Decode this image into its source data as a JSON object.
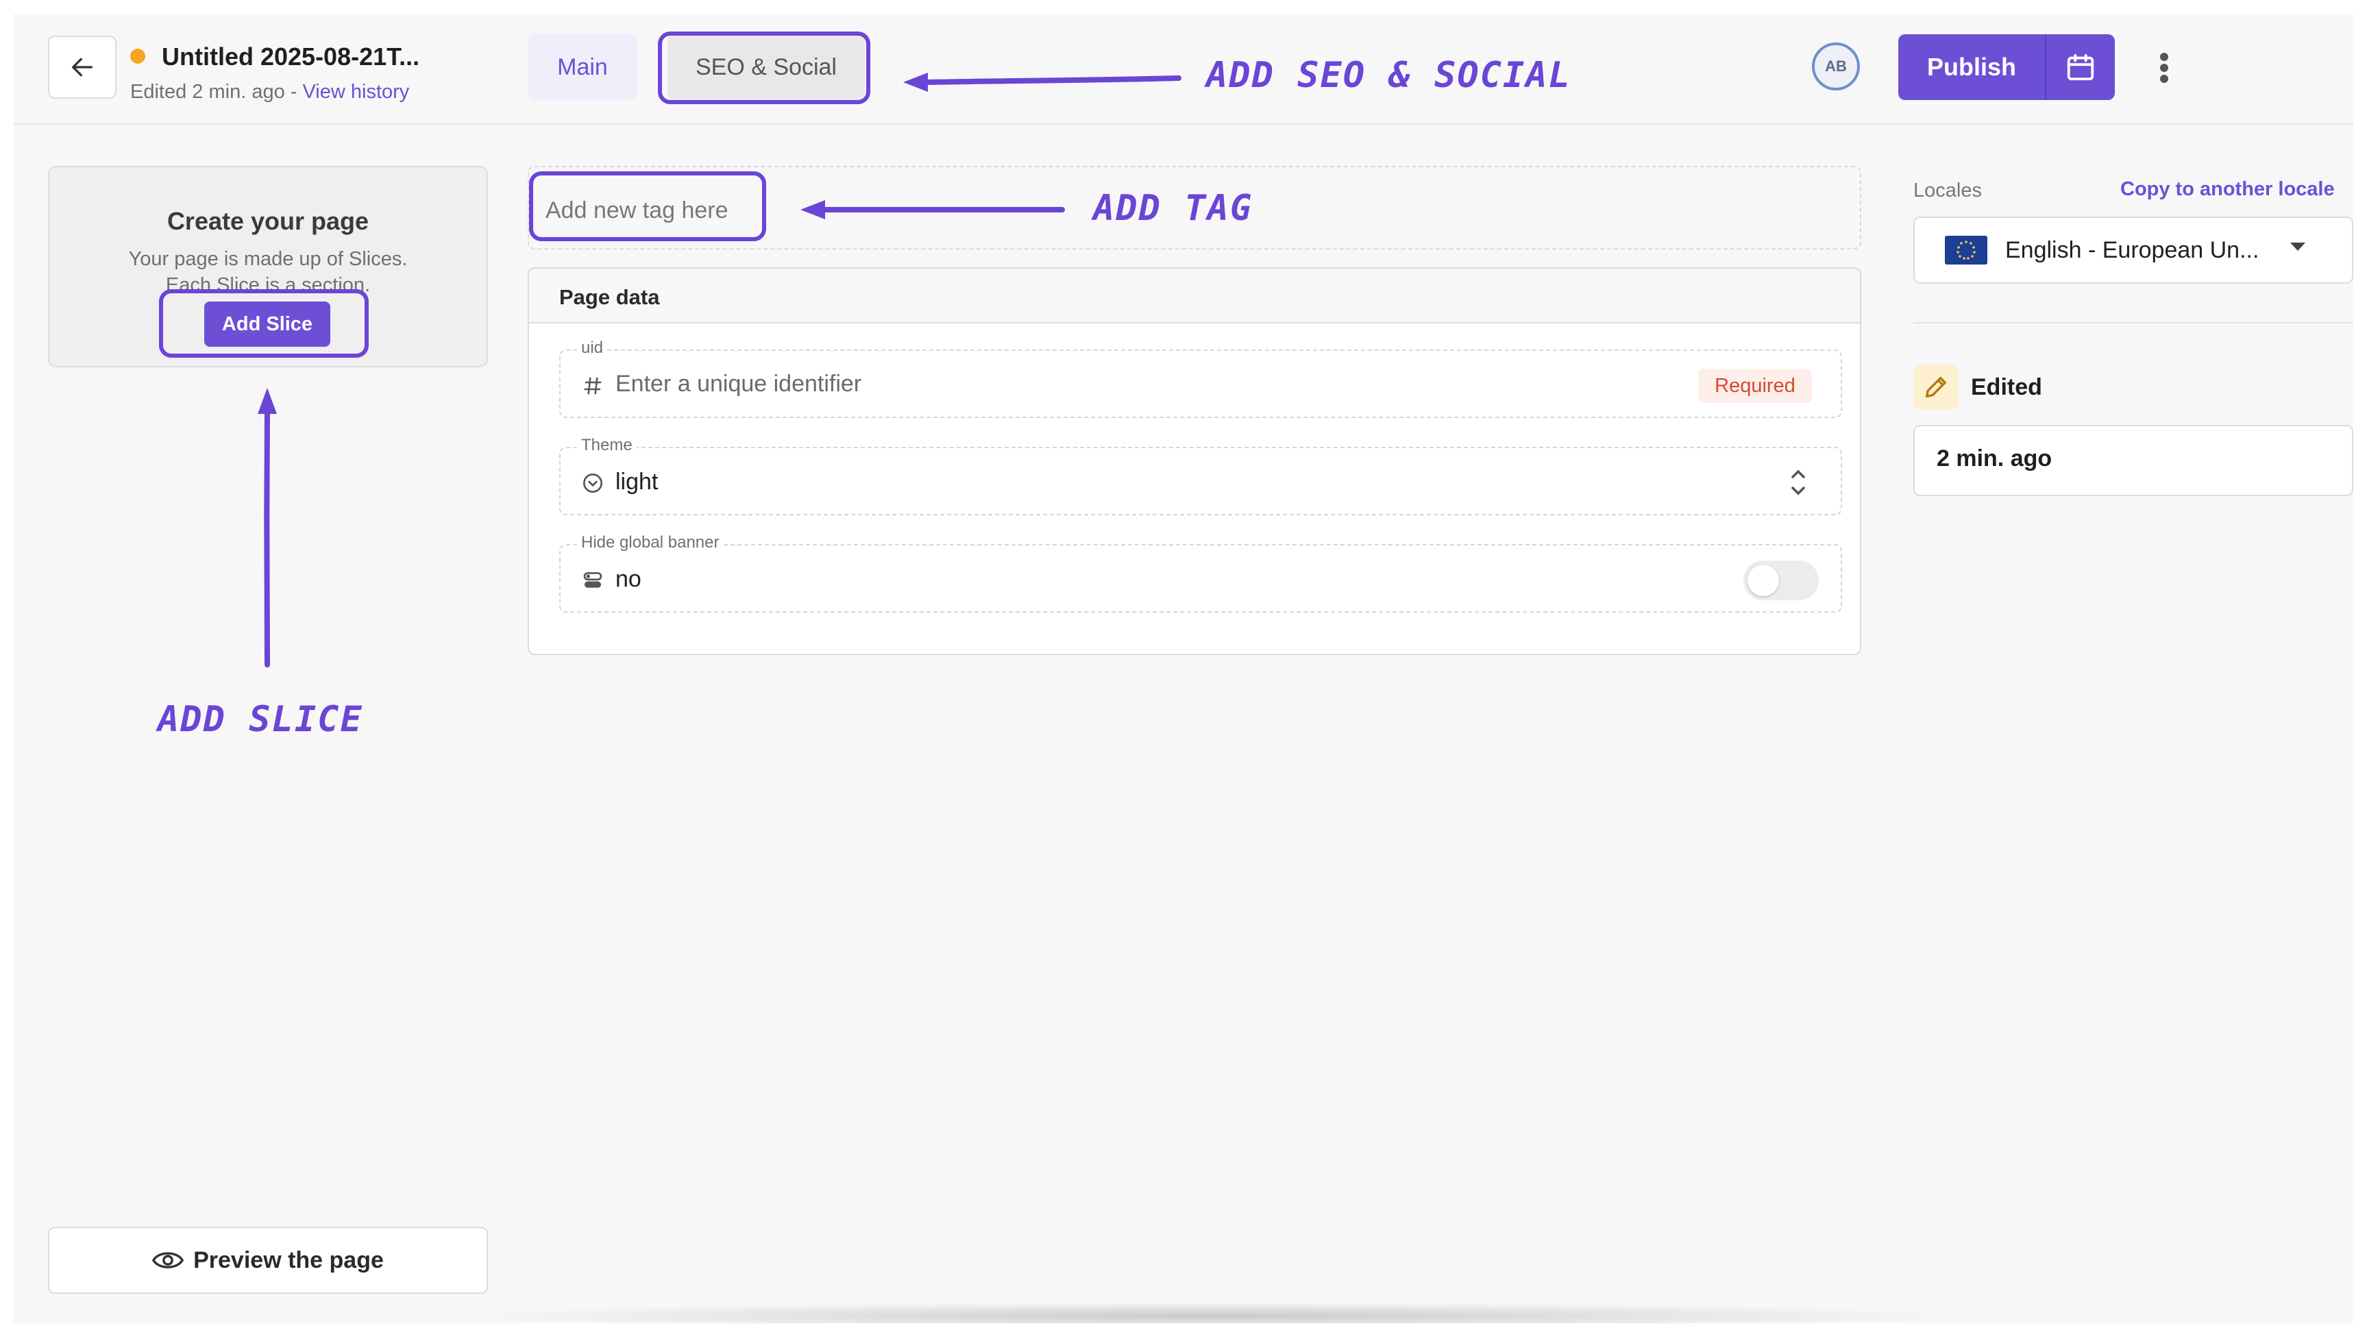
{
  "header": {
    "doc_title": "Untitled 2025-08-21T...",
    "edited_text": "Edited 2 min. ago - ",
    "view_history": "View history",
    "tabs": [
      {
        "label": "Main",
        "active": true
      },
      {
        "label": "SEO & Social",
        "active": false
      }
    ],
    "avatar_initials": "AB",
    "publish_label": "Publish",
    "status_color": "#f5a623",
    "accent_color": "#6d4fd6"
  },
  "annotations": {
    "seo": "ADD SEO & SOCIAL",
    "tag": "ADD TAG",
    "slice": "ADD SLICE",
    "color": "#6a45d6"
  },
  "sidebar": {
    "create_title": "Create your page",
    "create_desc_line1": "Your page is made up of Slices.",
    "create_desc_line2": "Each Slice is a section.",
    "add_slice_label": "Add Slice",
    "preview_label": "Preview the page"
  },
  "tags": {
    "placeholder": "Add new tag here"
  },
  "page_data": {
    "title": "Page data",
    "fields": {
      "uid": {
        "label": "uid",
        "placeholder": "Enter a unique identifier",
        "badge": "Required"
      },
      "theme": {
        "label": "Theme",
        "value": "light"
      },
      "banner": {
        "label": "Hide global banner",
        "value": "no",
        "toggle_on": false
      }
    }
  },
  "right_panel": {
    "locales_label": "Locales",
    "copy_locale": "Copy to another locale",
    "locale_value": "English - European Un...",
    "status_label": "Edited",
    "status_time": "2 min. ago"
  }
}
